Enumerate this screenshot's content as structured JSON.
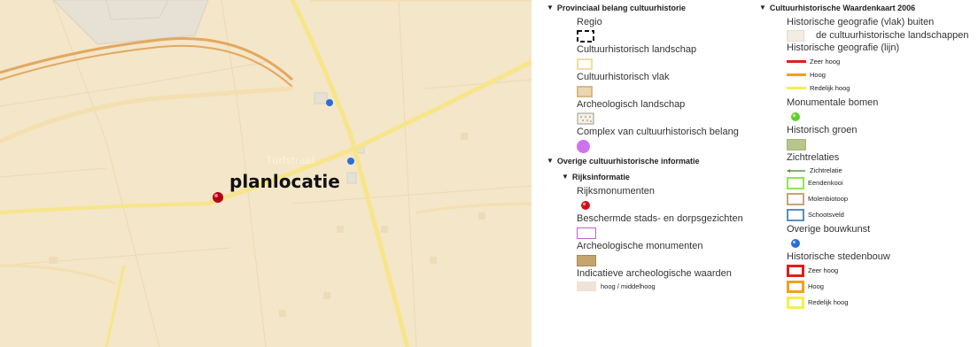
{
  "map": {
    "street_label": "Turfstraat",
    "place_label": "planlocatie"
  },
  "legend_left": {
    "section1": {
      "title": "Provinciaal belang cultuurhistorie",
      "items": [
        "Regio",
        "Cultuurhistorisch landschap",
        "Cultuurhistorisch vlak",
        "Archeologisch landschap",
        "Complex van cultuurhistorisch belang"
      ]
    },
    "section2": {
      "title": "Overige cultuurhistorische informatie",
      "subsection": {
        "title": "Rijksinformatie",
        "items": [
          "Rijksmonumenten",
          "Beschermde stads- en dorpsgezichten",
          "Archeologische monumenten",
          "Indicatieve archeologische waarden"
        ],
        "iaw_value": "hoog / middelhoog"
      }
    }
  },
  "legend_right": {
    "title": "Cultuurhistorische Waardenkaart 2006",
    "hg_vlak_line1": "Historische geografie (vlak) buiten",
    "hg_vlak_line2": "de cultuurhistorische landschappen",
    "hg_lijn": "Historische geografie (lijn)",
    "lijn_items": [
      "Zeer hoog",
      "Hoog",
      "Redelijk hoog"
    ],
    "monumentale_bomen": "Monumentale bomen",
    "historisch_groen": "Historisch groen",
    "zichtrelaties": "Zichtrelaties",
    "zicht_items": [
      "Zichtrelatie",
      "Eendenkooi",
      "Molenbiotoop",
      "Schootsveld"
    ],
    "overige_bouwkunst": "Overige bouwkunst",
    "historische_stedenbouw": "Historische stedenbouw",
    "stedenbouw_items": [
      "Zeer hoog",
      "Hoog",
      "Redelijk hoog"
    ]
  },
  "colors": {
    "map_background": "#f4e6c8",
    "road_yellow": "#f7e58a",
    "road_orange": "#e2a860",
    "marker_red": "#b3001a",
    "marker_blue": "#2a6fd6",
    "line_zeer_hoog": "#e21d1d",
    "line_hoog": "#f0a020",
    "line_redelijk_hoog": "#f5ee50",
    "monumentale_bomen": "#5cd12a",
    "historisch_groen": "#b7c68a",
    "complex_purple": "#cf72f0"
  }
}
